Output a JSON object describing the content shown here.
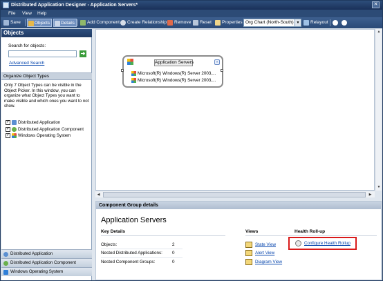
{
  "window": {
    "title": "Distributed Application Designer - Application Servers*"
  },
  "menu": {
    "items": [
      "File",
      "View",
      "Help"
    ]
  },
  "toolbar": {
    "save": "Save",
    "objects": "Objects",
    "details": "Details",
    "add_component": "Add Component",
    "create_relationship": "Create Relationship",
    "remove": "Remove",
    "reset": "Reset",
    "properties": "Properties",
    "layout_value": "Org Chart (North-South)",
    "relayout": "Relayout"
  },
  "left_pane": {
    "title": "Objects",
    "search_label": "Search for objects:",
    "advanced_search": "Advanced Search",
    "organize_header": "Organize Object Types",
    "organize_desc": "Only 7 Object Types can be visible in the Object Picker. In this window, you can organize what Object Types you want to make visible and which ones you want to not show.",
    "types": [
      {
        "label": "Distributed Application",
        "checked": true
      },
      {
        "label": "Distributed Application Component",
        "checked": true
      },
      {
        "label": "Windows Operating System",
        "checked": true
      }
    ],
    "bottom_nav": [
      "Distributed Application",
      "Distributed Application Component",
      "Windows Operating System"
    ]
  },
  "canvas": {
    "group_title": "Application Servers",
    "components": [
      "Microsoft(R) Windows(R) Server 2003,...",
      "Microsoft(R) Windows(R) Server 2003,..."
    ]
  },
  "details": {
    "header": "Component Group details",
    "title": "Application Servers",
    "key_details": {
      "heading": "Key Details",
      "rows": [
        {
          "label": "Objects:",
          "value": "2"
        },
        {
          "label": "Nested Distributed Applications:",
          "value": "0"
        },
        {
          "label": "Nested Component Groups:",
          "value": "0"
        }
      ]
    },
    "views": {
      "heading": "Views",
      "links": [
        "State View",
        "Alert View",
        "Diagram View"
      ]
    },
    "health": {
      "heading": "Health Roll-up",
      "link": "Configure Health Rollup"
    }
  }
}
